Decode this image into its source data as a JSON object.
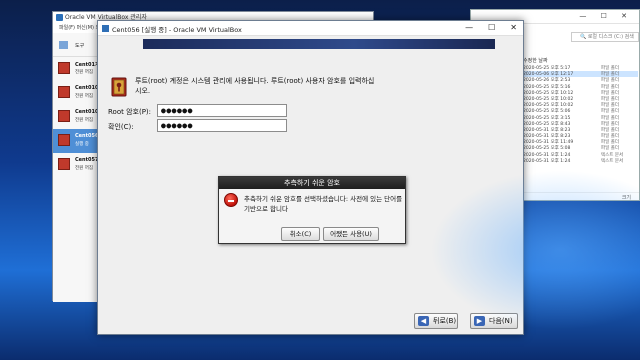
{
  "manager": {
    "title": "Oracle VM VirtualBox 관리자",
    "menu": "파일(F)  머신(M)  도움말(H)",
    "tools_label": "도구",
    "vms": [
      {
        "name": "Cent01가",
        "status": "전원 꺼짐",
        "selected": false
      },
      {
        "name": "Cent0102",
        "status": "전원 꺼짐",
        "selected": false
      },
      {
        "name": "Cent0103",
        "status": "전원 꺼짐",
        "selected": false
      },
      {
        "name": "Cent056",
        "status": "실행 중",
        "selected": true
      },
      {
        "name": "Cent057",
        "status": "전원 꺼짐",
        "selected": false
      }
    ]
  },
  "explorer": {
    "address": "🔍 로컬 디스크 (C:) 검색",
    "col_header": "수정한 날짜",
    "rows": [
      {
        "date": "2020-05-25 오후 5:17",
        "type": "파일 폴더"
      },
      {
        "date": "2020-05-06 오후 12:17",
        "type": "파일 폴더",
        "selected": true
      },
      {
        "date": "2020-05-26 오후 2:53",
        "type": "파일 폴더"
      },
      {
        "date": "2020-05-25 오후 5:16",
        "type": "파일 폴더"
      },
      {
        "date": "2020-05-25 오후 10:12",
        "type": "파일 폴더"
      },
      {
        "date": "2020-05-25 오후 10:02",
        "type": "파일 폴더"
      },
      {
        "date": "2020-05-25 오후 10:02",
        "type": "파일 폴더"
      },
      {
        "date": "2020-05-25 오후 5:06",
        "type": "파일 폴더"
      },
      {
        "date": "2020-05-25 오후 3:15",
        "type": "파일 폴더"
      },
      {
        "date": "2020-05-25 오후 8:43",
        "type": "파일 폴더"
      },
      {
        "date": "2020-05-31 오후 8:23",
        "type": "파일 폴더"
      },
      {
        "date": "2020-05-31 오후 8:23",
        "type": "파일 폴더"
      },
      {
        "date": "2020-05-31 오후 11:49",
        "type": "파일 폴더"
      },
      {
        "date": "2020-05-25 오후 5:08",
        "type": "파일 폴더"
      },
      {
        "date": "2020-05-31 오후 1:24",
        "type": "텍스트 문서"
      },
      {
        "date": "2020-05-31 오후 1:24",
        "type": "텍스트 문서"
      }
    ],
    "footer": "크기"
  },
  "vm_window": {
    "title": "Cent056 [실행 중] - Oracle VM VirtualBox",
    "controls": [
      "—",
      "☐",
      "✕"
    ]
  },
  "installer": {
    "intro": "루트(root) 계정은 시스템 관리에 사용됩니다. 루트(root) 사용자 암호를 입력하십시오.",
    "root_label": "Root 암호(P):",
    "confirm_label": "확인(C):",
    "root_value": "●●●●●●",
    "confirm_value": "●●●●●●",
    "back_label": "뒤로(B)",
    "next_label": "다음(N)"
  },
  "dialog": {
    "title": "추측하기 쉬운 암호",
    "message": "추측하기 쉬운 암호를 선택하셨습니다: 사전에 있는 단어를 기반으로 합니다",
    "cancel_label": "취소(C)",
    "use_label": "어쨌든 사용(U)"
  },
  "colors": {
    "dialog_title_bg": "#1e1e1e",
    "selected_vm": "#4f8fd6",
    "error_red": "#c0120a"
  }
}
